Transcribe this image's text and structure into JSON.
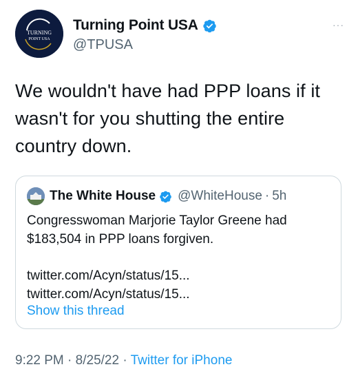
{
  "author": {
    "name": "Turning Point USA",
    "handle": "@TPUSA",
    "avatar_text_line1": "TURNING",
    "avatar_text_line2": "POINT USA"
  },
  "more_icon": "···",
  "tweet": {
    "text": "We wouldn't have had PPP loans if it wasn't for you shutting the entire country down."
  },
  "quoted": {
    "name": "The White House",
    "handle": "@WhiteHouse",
    "separator": "·",
    "time": "5h",
    "text": "Congresswoman Marjorie Taylor Greene had $183,504 in PPP loans forgiven.",
    "links": "twitter.com/Acyn/status/15... twitter.com/Acyn/status/15...",
    "show_thread": "Show this thread"
  },
  "meta": {
    "time": "9:22 PM",
    "dot1": "·",
    "date": "8/25/22",
    "dot2": "·",
    "app": "Twitter for iPhone"
  },
  "colors": {
    "link": "#1d9bf0",
    "secondary_text": "#536471",
    "border": "#cfd9de",
    "tpusa_navy": "#0d1b3e"
  },
  "icons": {
    "verified": "verified-badge-icon",
    "more": "more-options-icon"
  }
}
